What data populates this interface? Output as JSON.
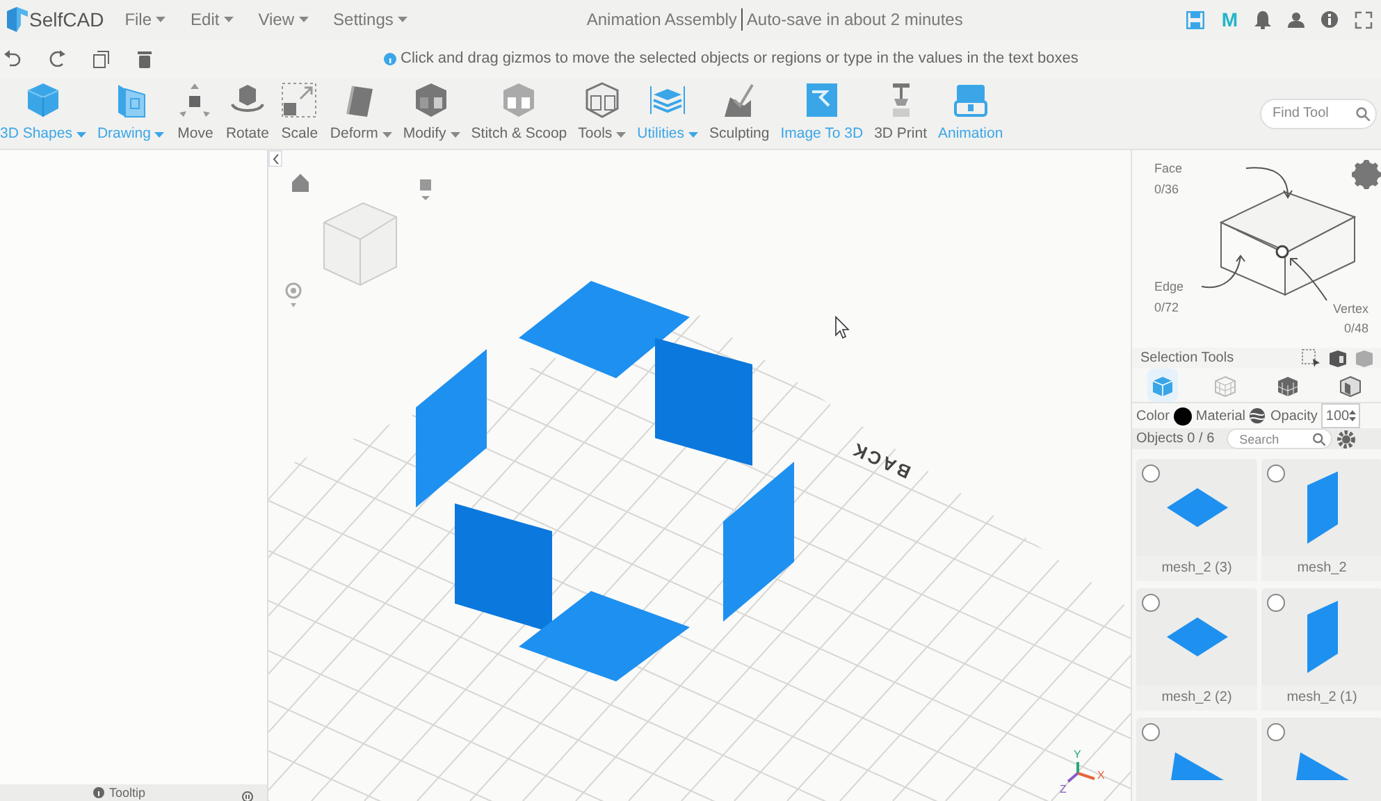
{
  "app": {
    "name": "SelfCAD"
  },
  "menu": [
    {
      "label": "File"
    },
    {
      "label": "Edit"
    },
    {
      "label": "View"
    },
    {
      "label": "Settings"
    }
  ],
  "document": {
    "title": "Animation Assembly",
    "autosave": "Auto-save in about 2 minutes"
  },
  "header_badge": "M",
  "hint": "Click and drag gizmos to move the selected objects or regions or type in the values in the text boxes",
  "tools": [
    {
      "label": "3D Shapes",
      "kind": "cube",
      "highlighted": true,
      "dropdown": true
    },
    {
      "label": "Drawing",
      "kind": "drawing",
      "highlighted": true,
      "dropdown": true
    },
    {
      "label": "Move",
      "kind": "move",
      "highlighted": false,
      "dropdown": false
    },
    {
      "label": "Rotate",
      "kind": "rotate",
      "highlighted": false,
      "dropdown": false
    },
    {
      "label": "Scale",
      "kind": "scale",
      "highlighted": false,
      "dropdown": false
    },
    {
      "label": "Deform",
      "kind": "deform",
      "highlighted": false,
      "dropdown": true
    },
    {
      "label": "Modify",
      "kind": "modify",
      "highlighted": false,
      "dropdown": true
    },
    {
      "label": "Stitch & Scoop",
      "kind": "stitch",
      "highlighted": false,
      "dropdown": false
    },
    {
      "label": "Tools",
      "kind": "tools",
      "highlighted": false,
      "dropdown": true
    },
    {
      "label": "Utilities",
      "kind": "utilities",
      "highlighted": true,
      "dropdown": true
    },
    {
      "label": "Sculpting",
      "kind": "sculpt",
      "highlighted": false,
      "dropdown": false
    },
    {
      "label": "Image To 3D",
      "kind": "image",
      "highlighted": true,
      "dropdown": false
    },
    {
      "label": "3D Print",
      "kind": "print",
      "highlighted": false,
      "dropdown": false
    },
    {
      "label": "Animation",
      "kind": "animation",
      "highlighted": true,
      "dropdown": false
    }
  ],
  "find_tool": {
    "placeholder": "Find Tool"
  },
  "left_panel": {
    "tooltip": "Tooltip"
  },
  "viewport": {
    "back_label": "BACK",
    "axes": [
      {
        "label": "Y",
        "color": "#2aa876"
      },
      {
        "label": "X",
        "color": "#e8663a"
      },
      {
        "label": "Z",
        "color": "#8a5cc8"
      }
    ]
  },
  "selection": {
    "face_label": "Face",
    "face_count": "0/36",
    "edge_label": "Edge",
    "edge_count": "0/72",
    "vertex_label": "Vertex",
    "vertex_count": "0/48",
    "tools_label": "Selection Tools",
    "modes": [
      {
        "kind": "solid",
        "selected": true
      },
      {
        "kind": "wireframe",
        "selected": false
      },
      {
        "kind": "voxel",
        "selected": false
      },
      {
        "kind": "shaded",
        "selected": false
      }
    ]
  },
  "properties": {
    "color_label": "Color",
    "color": "#000000",
    "material_label": "Material",
    "opacity_label": "Opacity",
    "opacity": "100"
  },
  "objects": {
    "label": "Objects 0 / 6",
    "search_placeholder": "Search",
    "items": [
      {
        "name": "mesh_2 (3)",
        "kind": "flat",
        "checked": false
      },
      {
        "name": "mesh_2",
        "kind": "upright",
        "checked": false
      },
      {
        "name": "mesh_2 (2)",
        "kind": "flat",
        "checked": false
      },
      {
        "name": "mesh_2 (1)",
        "kind": "upright",
        "checked": false
      },
      {
        "kind": "wedge",
        "checked": false
      },
      {
        "kind": "wedge",
        "checked": false
      }
    ]
  }
}
